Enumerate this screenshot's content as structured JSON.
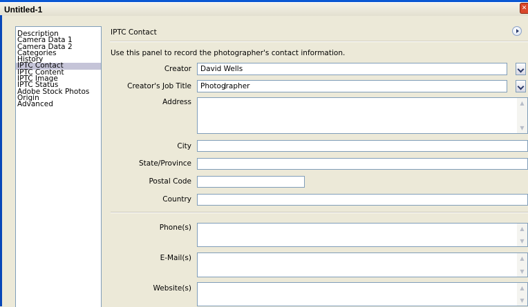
{
  "window": {
    "title": "Untitled-1"
  },
  "sidebar": {
    "items": [
      {
        "label": "Description",
        "selected": false
      },
      {
        "label": "Camera Data 1",
        "selected": false
      },
      {
        "label": "Camera Data 2",
        "selected": false
      },
      {
        "label": "Categories",
        "selected": false
      },
      {
        "label": "History",
        "selected": false
      },
      {
        "label": "IPTC Contact",
        "selected": true
      },
      {
        "label": "IPTC Content",
        "selected": false
      },
      {
        "label": "IPTC Image",
        "selected": false
      },
      {
        "label": "IPTC Status",
        "selected": false
      },
      {
        "label": "Adobe Stock Photos",
        "selected": false
      },
      {
        "label": "Origin",
        "selected": false
      },
      {
        "label": "Advanced",
        "selected": false
      }
    ]
  },
  "panel": {
    "header": "IPTC Contact",
    "intro": "Use this panel to record the photographer's contact information.",
    "creator": {
      "label": "Creator",
      "value": "David Wells"
    },
    "job_title": {
      "label": "Creator's Job Title",
      "value": "Photographer"
    },
    "address": {
      "label": "Address",
      "value": ""
    },
    "city": {
      "label": "City",
      "value": ""
    },
    "state": {
      "label": "State/Province",
      "value": ""
    },
    "postal": {
      "label": "Postal Code",
      "value": ""
    },
    "country": {
      "label": "Country",
      "value": ""
    },
    "phone": {
      "label": "Phone(s)",
      "value": ""
    },
    "email": {
      "label": "E-Mail(s)",
      "value": ""
    },
    "website": {
      "label": "Website(s)",
      "value": ""
    }
  }
}
